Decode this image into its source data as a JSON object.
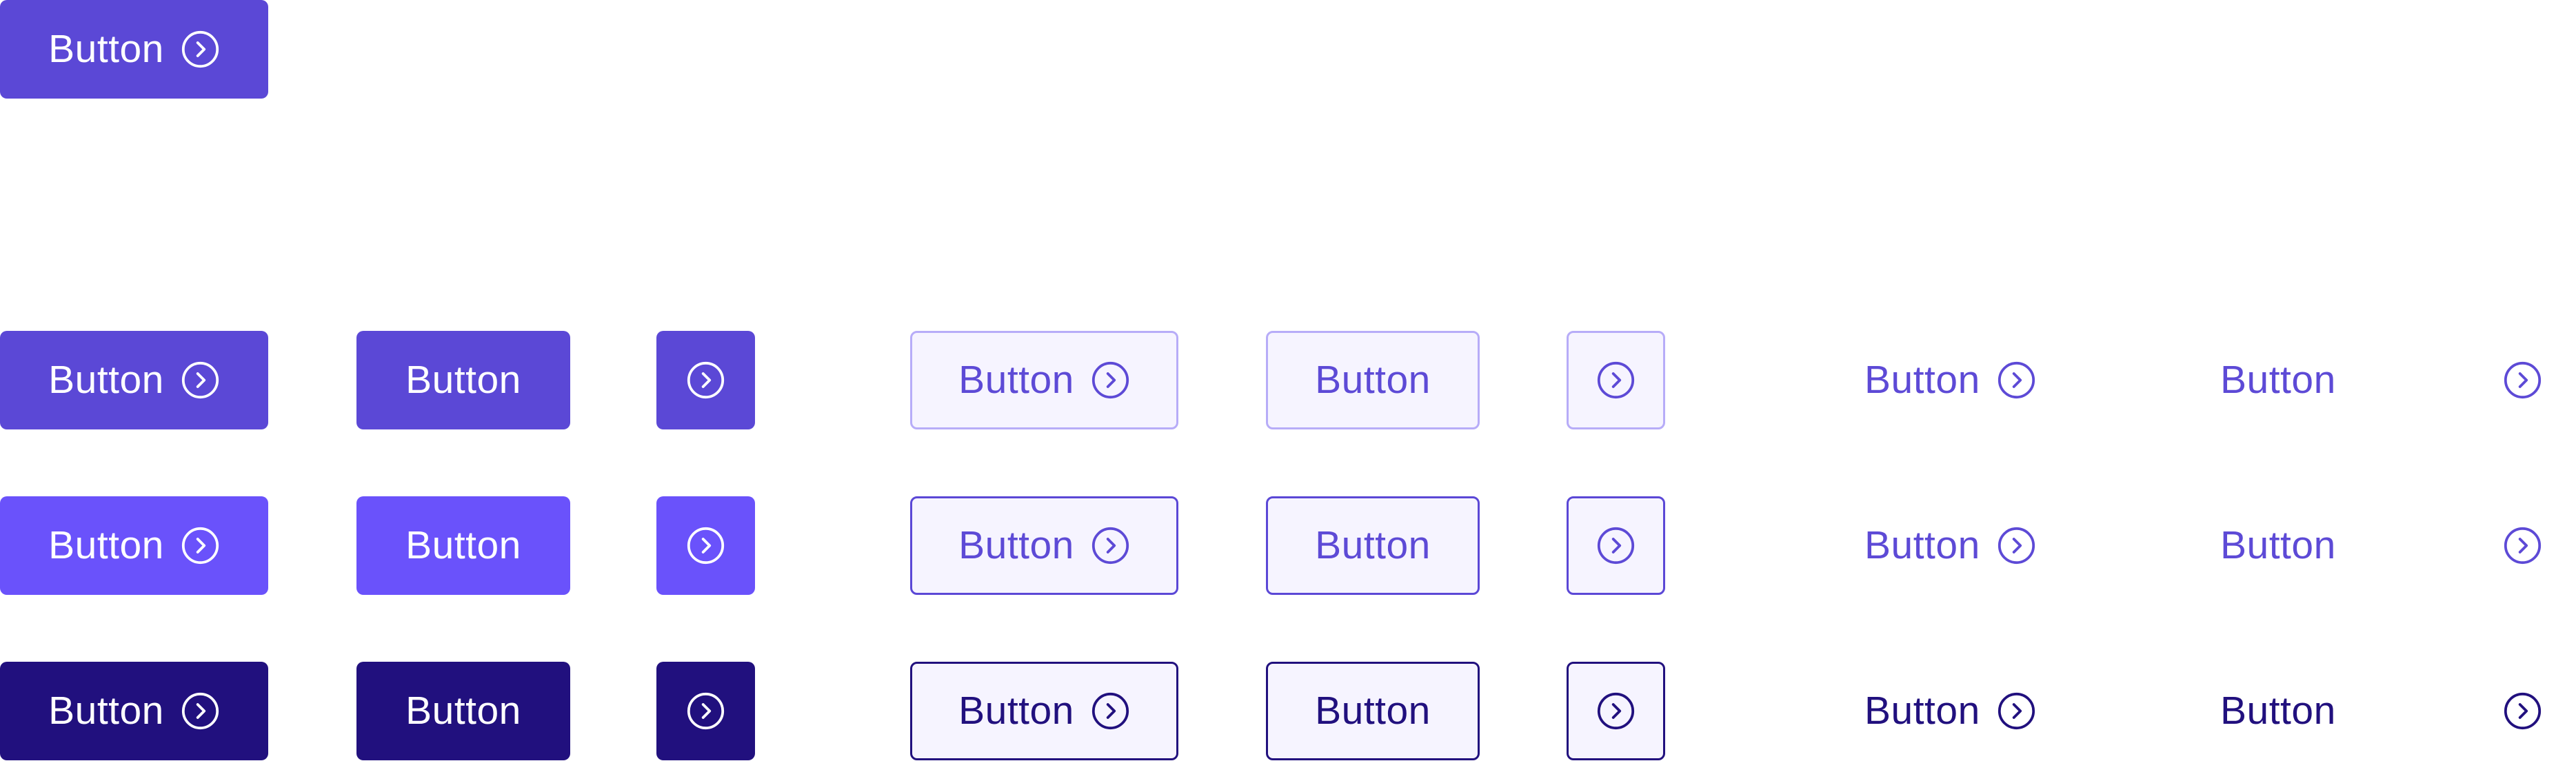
{
  "button_label": "Button",
  "colors": {
    "solid_default": "#5b48d6",
    "solid_hover": "#6a52fb",
    "solid_pressed": "#21107e",
    "outline_fill": "#f6f4ff",
    "outline_default_border": "#b7acf8",
    "text_default": "#5d4ad6",
    "text_pressed": "#21107e",
    "on_solid_text": "#ffffff"
  },
  "icon": "chevron-right-circle-icon",
  "showcase": {
    "label": "Button"
  },
  "rows": [
    {
      "state": "default",
      "solid": {
        "full": "Button",
        "text": "Button"
      },
      "outline": {
        "full": "Button",
        "text": "Button"
      },
      "ghost": {
        "full": "Button",
        "text": "Button"
      }
    },
    {
      "state": "hover",
      "solid": {
        "full": "Button",
        "text": "Button"
      },
      "outline": {
        "full": "Button",
        "text": "Button"
      },
      "ghost": {
        "full": "Button",
        "text": "Button"
      }
    },
    {
      "state": "pressed",
      "solid": {
        "full": "Button",
        "text": "Button"
      },
      "outline": {
        "full": "Button",
        "text": "Button"
      },
      "ghost": {
        "full": "Button",
        "text": "Button"
      }
    }
  ]
}
